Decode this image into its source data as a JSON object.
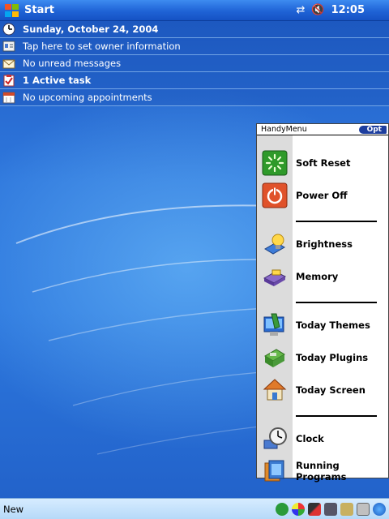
{
  "titlebar": {
    "start_label": "Start",
    "connectivity_glyph": "⇄",
    "volume_glyph": "🔇",
    "time": "12:05"
  },
  "today": {
    "date": "Sunday, October 24, 2004",
    "owner": "Tap here to set owner information",
    "messages": "No unread messages",
    "tasks": "1 Active task",
    "appointments": "No upcoming appointments"
  },
  "handymenu": {
    "title": "HandyMenu",
    "opt_label": "Opt",
    "items": [
      {
        "label": "Soft Reset",
        "icon": "soft-reset-icon"
      },
      {
        "label": "Power Off",
        "icon": "power-icon"
      },
      {
        "label": "Brightness",
        "icon": "brightness-icon"
      },
      {
        "label": "Memory",
        "icon": "memory-icon"
      },
      {
        "label": "Today Themes",
        "icon": "themes-icon"
      },
      {
        "label": "Today Plugins",
        "icon": "plugins-icon"
      },
      {
        "label": "Today Screen",
        "icon": "home-icon"
      },
      {
        "label": "Clock",
        "icon": "clock-icon"
      },
      {
        "label": "Running Programs",
        "icon": "running-programs-icon"
      }
    ]
  },
  "bottombar": {
    "new_label": "New"
  },
  "colors": {
    "titlebar": "#1f63d6",
    "wallpaper": "#2f78dd",
    "handy_strip": "#dcdcdc",
    "opt_button": "#1d3e9e"
  }
}
